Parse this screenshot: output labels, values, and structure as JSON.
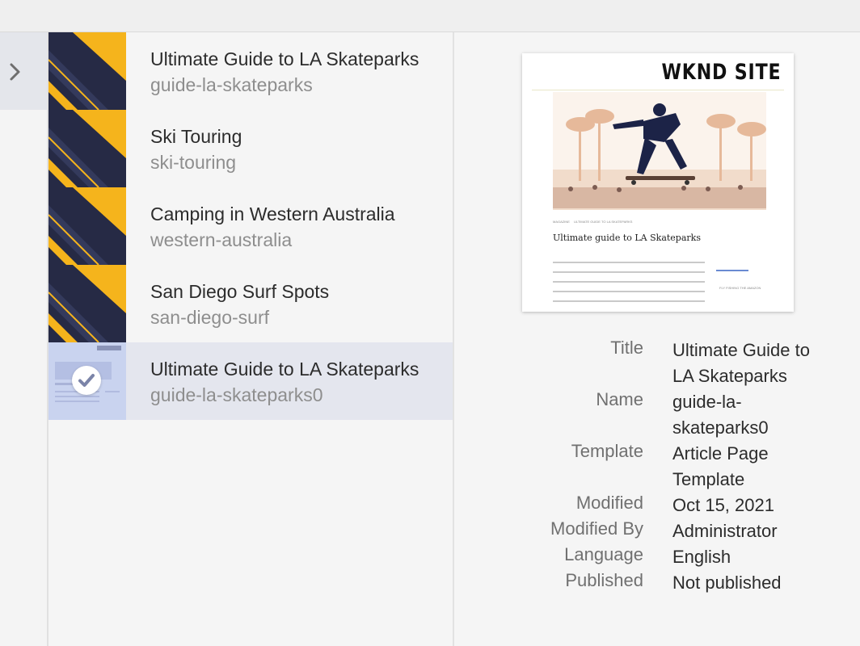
{
  "pages": [
    {
      "title": "Ultimate Guide to LA Skateparks",
      "name": "guide-la-skateparks"
    },
    {
      "title": "Ski Touring",
      "name": "ski-touring"
    },
    {
      "title": "Camping in Western Australia",
      "name": "western-australia"
    },
    {
      "title": "San Diego Surf Spots",
      "name": "san-diego-surf"
    },
    {
      "title": "Ultimate Guide to LA Skateparks",
      "name": "guide-la-skateparks0"
    }
  ],
  "preview": {
    "logo": "WKND SITE",
    "headline": "Ultimate guide to LA Skateparks",
    "breadcrumb_a": "MAGAZINE",
    "breadcrumb_b": "ULTIMATE GUIDE TO LA SKATEPARKS",
    "sidebar_title": "FLY FISHING THE AMAZON"
  },
  "details": {
    "labels": {
      "title": "Title",
      "name": "Name",
      "template": "Template",
      "modified": "Modified",
      "modified_by": "Modified By",
      "language": "Language",
      "published": "Published"
    },
    "values": {
      "title": "Ultimate Guide to LA Skateparks",
      "name": "guide-la-skateparks0",
      "template": "Article Page Template",
      "modified": "Oct 15, 2021",
      "modified_by": "Administrator",
      "language": "English",
      "published": "Not published"
    }
  },
  "colors": {
    "selected_row": "#e4e6ee",
    "thumb_dark": "#262a45",
    "thumb_yellow": "#f5b41c"
  },
  "icons": {
    "expand": "chevron-right-icon",
    "selected": "checkmark-icon"
  }
}
